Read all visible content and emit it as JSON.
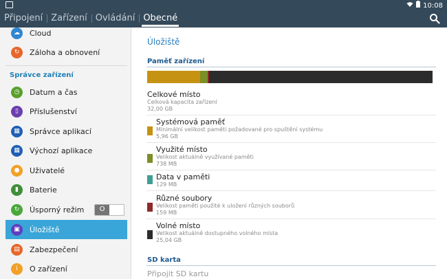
{
  "status": {
    "time": "10:08"
  },
  "tabs": [
    {
      "label": "Připojení"
    },
    {
      "label": "Zařízení"
    },
    {
      "label": "Ovládání"
    },
    {
      "label": "Obecné"
    }
  ],
  "sidebar": {
    "items_top": [
      {
        "label": "Cloud",
        "color": "#2f86d0",
        "icon": "cloud-icon"
      },
      {
        "label": "Záloha a obnovení",
        "color": "#e8662a",
        "icon": "backup-icon"
      }
    ],
    "section_title": "Správce zařízení",
    "items": [
      {
        "label": "Datum a čas",
        "color": "#5aa02c",
        "icon": "clock-icon"
      },
      {
        "label": "Příslušenství",
        "color": "#6b3fb0",
        "icon": "accessory-icon"
      },
      {
        "label": "Správce aplikací",
        "color": "#1f5fb5",
        "icon": "apps-grid-icon"
      },
      {
        "label": "Výchozí aplikace",
        "color": "#1f5fb5",
        "icon": "default-apps-icon"
      },
      {
        "label": "Uživatelé",
        "color": "#f2a126",
        "icon": "users-icon"
      },
      {
        "label": "Baterie",
        "color": "#3f8f3a",
        "icon": "battery-icon"
      },
      {
        "label": "Úsporný režim",
        "color": "#4aa83a",
        "icon": "power-saving-icon",
        "toggle": "O"
      },
      {
        "label": "Úložiště",
        "color": "#5f3fc0",
        "icon": "storage-icon",
        "selected": true
      },
      {
        "label": "Zabezpečení",
        "color": "#e8662a",
        "icon": "lock-icon"
      },
      {
        "label": "O zařízení",
        "color": "#f2a126",
        "icon": "info-icon"
      }
    ]
  },
  "main": {
    "title": "Úložiště",
    "device_section": "Paměť zařízení",
    "storage_bar": [
      {
        "name": "system",
        "color": "#c69212",
        "fraction": 0.186
      },
      {
        "name": "used",
        "color": "#7d8f27",
        "fraction": 0.023
      },
      {
        "name": "cache",
        "color": "#3f9f95",
        "fraction": 0.004
      },
      {
        "name": "misc",
        "color": "#8e2a2a",
        "fraction": 0.005
      },
      {
        "name": "free",
        "color": "#2c2c2c",
        "fraction": 0.782
      }
    ],
    "total": {
      "title": "Celkové místo",
      "sub": "Celková kapacita zařízení",
      "value": "32,00 GB"
    },
    "rows": [
      {
        "title": "Systémová paměť",
        "sub": "Minimální velikost paměti požadované pro spuštění systému",
        "value": "5,96 GB",
        "color": "#c69212"
      },
      {
        "title": "Využité místo",
        "sub": "Velikost aktuálně využívané paměti",
        "value": "738 MB",
        "color": "#7d8f27"
      },
      {
        "title": "Data v paměti",
        "sub": "",
        "value": "129 MB",
        "color": "#3f9f95"
      },
      {
        "title": "Různé soubory",
        "sub": "Velikost paměti použité k uložení různých souborů",
        "value": "159 MB",
        "color": "#8e2a2a"
      },
      {
        "title": "Volné místo",
        "sub": "Velikost aktuálně dostupného volného místa",
        "value": "25,04 GB",
        "color": "#2c2c2c"
      }
    ],
    "sd_section": "SD karta",
    "sd_link": "Připojit SD kartu"
  }
}
